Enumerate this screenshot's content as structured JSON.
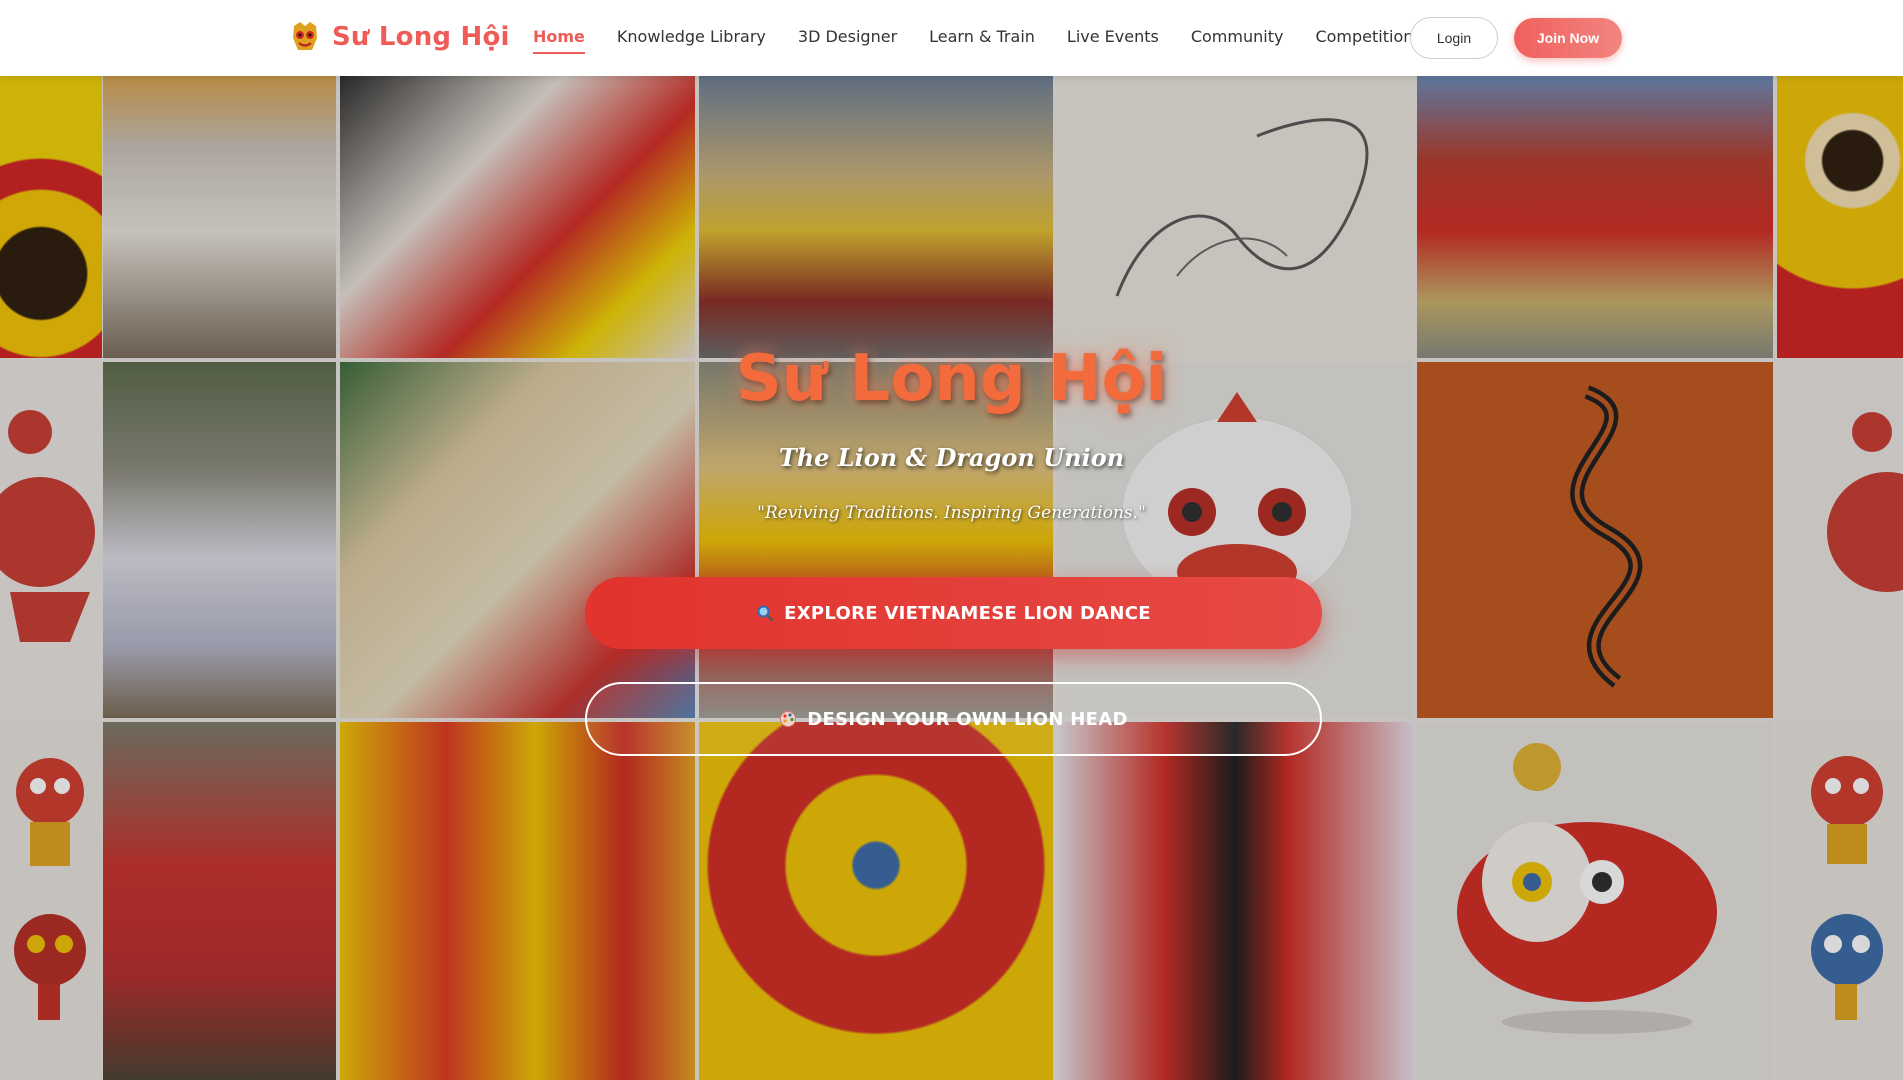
{
  "brand": {
    "name": "Sư Long Hội",
    "logo_icon": "lion-head-icon"
  },
  "nav": {
    "items": [
      {
        "label": "Home",
        "active": true
      },
      {
        "label": "Knowledge Library",
        "active": false
      },
      {
        "label": "3D Designer",
        "active": false
      },
      {
        "label": "Learn & Train",
        "active": false
      },
      {
        "label": "Live Events",
        "active": false
      },
      {
        "label": "Community",
        "active": false
      },
      {
        "label": "Competitions",
        "active": false
      }
    ],
    "login_label": "Login",
    "join_label": "Join Now"
  },
  "hero": {
    "title": "Sư Long Hội",
    "subtitle": "The Lion & Dragon Union",
    "quote": "\"Reviving Traditions. Inspiring Generations.\"",
    "primary_cta": {
      "label": "EXPLORE VIETNAMESE LION DANCE",
      "icon": "search-icon"
    },
    "secondary_cta": {
      "label": "DESIGN YOUR OWN LION HEAD",
      "icon": "palette-icon"
    }
  },
  "colors": {
    "accent": "#ef5b57",
    "cta": "#e2332d",
    "hero_title": "#f36a3d"
  }
}
